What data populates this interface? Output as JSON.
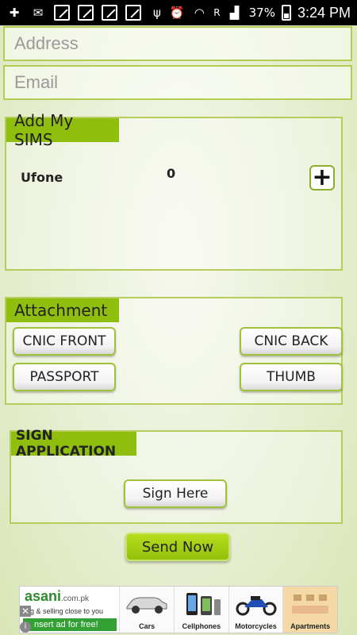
{
  "status_bar": {
    "battery": "37%",
    "time": "3:24 PM",
    "signal_label": "R"
  },
  "form": {
    "address_placeholder": "Address",
    "email_placeholder": "Email"
  },
  "sims": {
    "title": "Add My SIMS",
    "rows": [
      {
        "name": "Ufone",
        "count": "0"
      }
    ],
    "add_label": "+"
  },
  "attachment": {
    "title": "Attachment",
    "buttons": {
      "cnic_front": "CNIC FRONT",
      "cnic_back": "CNIC BACK",
      "passport": "PASSPORT",
      "thumb": "THUMB"
    }
  },
  "sign": {
    "title": "SIGN APPLICATION",
    "button": "Sign Here"
  },
  "send_button": "Send Now",
  "ad": {
    "brand": "asani",
    "brand_suffix": ".com.pk",
    "tagline": "ing & selling close to you",
    "cta": "nsert ad for free!",
    "categories": [
      "Cars",
      "Cellphones",
      "Motorcycles",
      "Apartments"
    ],
    "close": "✕",
    "info": "i"
  }
}
